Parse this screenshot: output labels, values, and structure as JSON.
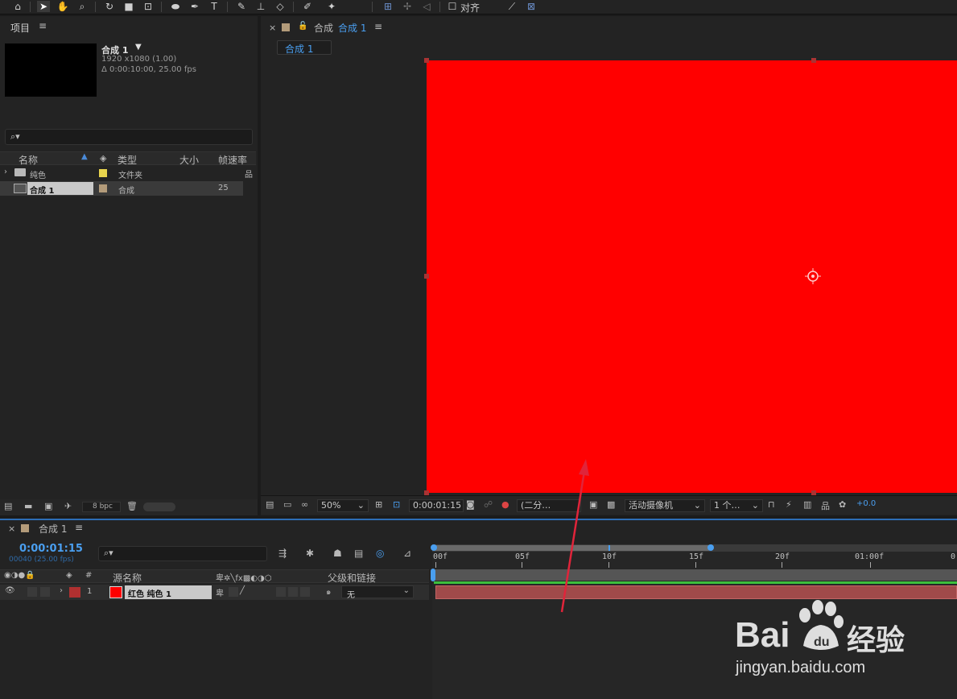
{
  "toolbar": {
    "align_label": "对齐"
  },
  "project": {
    "title": "项目",
    "comp_name": "合成 1",
    "comp_size": "1920 x1080 (1.00)",
    "comp_duration": "Δ 0:00:10:00, 25.00 fps",
    "columns": {
      "name": "名称",
      "type": "类型",
      "size": "大小",
      "fps": "帧速率"
    },
    "items": [
      {
        "name": "纯色",
        "type": "文件夹",
        "fps": "",
        "color": "#e8d44d"
      },
      {
        "name": "合成 1",
        "type": "合成",
        "fps": "25",
        "color": "#b39b7a"
      }
    ],
    "bpc": "8 bpc"
  },
  "viewer": {
    "tab_prefix": "合成",
    "tab_name": "合成 1",
    "subtab": "合成 1",
    "zoom": "50%",
    "timecode": "0:00:01:15",
    "resolution": "(二分…",
    "camera": "活动摄像机",
    "views": "1 个…",
    "exposure": "+0.0",
    "layer_color": "#ff0000"
  },
  "timeline": {
    "tab_name": "合成 1",
    "timecode": "0:00:01:15",
    "frame_info": "00040 (25.00 fps)",
    "ruler": [
      "00f",
      "05f",
      "10f",
      "15f",
      "20f",
      "01:00f",
      "0"
    ],
    "col_source": "源名称",
    "col_parent": "父级和链接",
    "layer": {
      "index": "1",
      "name": "红色 纯色 1",
      "parent": "无",
      "label_color": "#b03030"
    }
  },
  "watermark": {
    "brand": "Bai",
    "brand2": "经验",
    "url": "jingyan.baidu.com"
  }
}
